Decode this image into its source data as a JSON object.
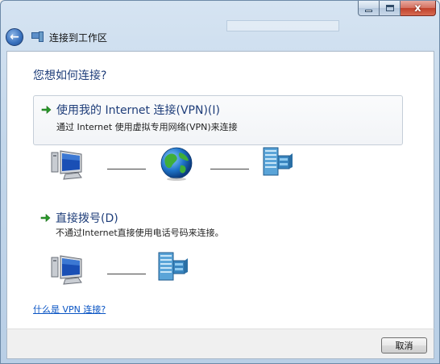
{
  "window": {
    "title": "连接到工作区",
    "caption_close": "x"
  },
  "nav": {
    "back_glyph": "←",
    "title": "连接到工作区"
  },
  "main": {
    "heading": "您想如何连接?",
    "options": [
      {
        "title": "使用我的 Internet 连接(VPN)(I)",
        "description": "通过 Internet 使用虚拟专用网络(VPN)来连接",
        "diagram": [
          "computer-icon",
          "globe-icon",
          "server-icon"
        ]
      },
      {
        "title": "直接拨号(D)",
        "description": "不通过Internet直接使用电话号码来连接。",
        "diagram": [
          "computer-icon",
          "server-icon"
        ]
      }
    ],
    "help_link": "什么是 VPN 连接?"
  },
  "footer": {
    "cancel_label": "取消"
  },
  "colors": {
    "heading": "#1f3e7a",
    "link": "#0a55c4",
    "arrow": "#2a9a2a"
  }
}
